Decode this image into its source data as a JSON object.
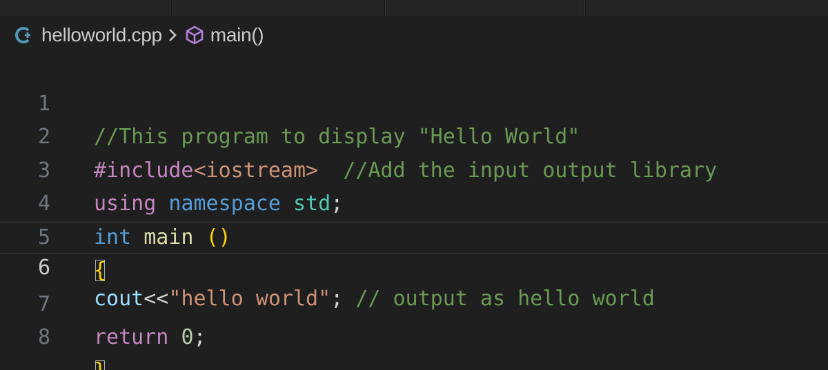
{
  "breadcrumb": {
    "file_icon": "cpp-file-icon",
    "file_name": "helloworld.cpp",
    "separator_icon": "chevron-right-icon",
    "symbol_icon": "method-cube-icon",
    "symbol_name": "main()"
  },
  "colors": {
    "background": "#1f1f1f",
    "comment": "#6a9955",
    "keyword": "#c586c0",
    "type": "#569cd6",
    "namespace": "#4ec9b0",
    "function": "#dcdcaa",
    "variable": "#9cdcfe",
    "string": "#ce9178",
    "number": "#b5cea8",
    "bracket": "#ffd700",
    "line_number": "#6e7681"
  },
  "code": {
    "current_line": "6",
    "lines": [
      {
        "num": "1",
        "tokens": [
          {
            "t": "//This program to display \"Hello World\""
          }
        ]
      },
      {
        "num": "2",
        "tokens": [
          {
            "t": "#include"
          },
          {
            "t": "<iostream>"
          },
          {
            "t": "  "
          },
          {
            "t": "//Add the input output library"
          }
        ]
      },
      {
        "num": "3",
        "tokens": [
          {
            "t": "using"
          },
          {
            "t": " "
          },
          {
            "t": "namespace"
          },
          {
            "t": " "
          },
          {
            "t": "std"
          },
          {
            "t": ";"
          }
        ]
      },
      {
        "num": "4",
        "tokens": [
          {
            "t": "int"
          },
          {
            "t": " "
          },
          {
            "t": "main"
          },
          {
            "t": " "
          },
          {
            "t": "()"
          }
        ]
      },
      {
        "num": "5",
        "tokens": [
          {
            "t": "{"
          }
        ]
      },
      {
        "num": "6",
        "tokens": [
          {
            "t": "cout"
          },
          {
            "t": "<<"
          },
          {
            "t": "\"hello world\""
          },
          {
            "t": ";"
          },
          {
            "t": " "
          },
          {
            "t": "// output as hello world"
          }
        ]
      },
      {
        "num": "7",
        "tokens": [
          {
            "t": "return"
          },
          {
            "t": " "
          },
          {
            "t": "0"
          },
          {
            "t": ";"
          }
        ]
      },
      {
        "num": "8",
        "tokens": [
          {
            "t": "}"
          }
        ]
      }
    ]
  }
}
